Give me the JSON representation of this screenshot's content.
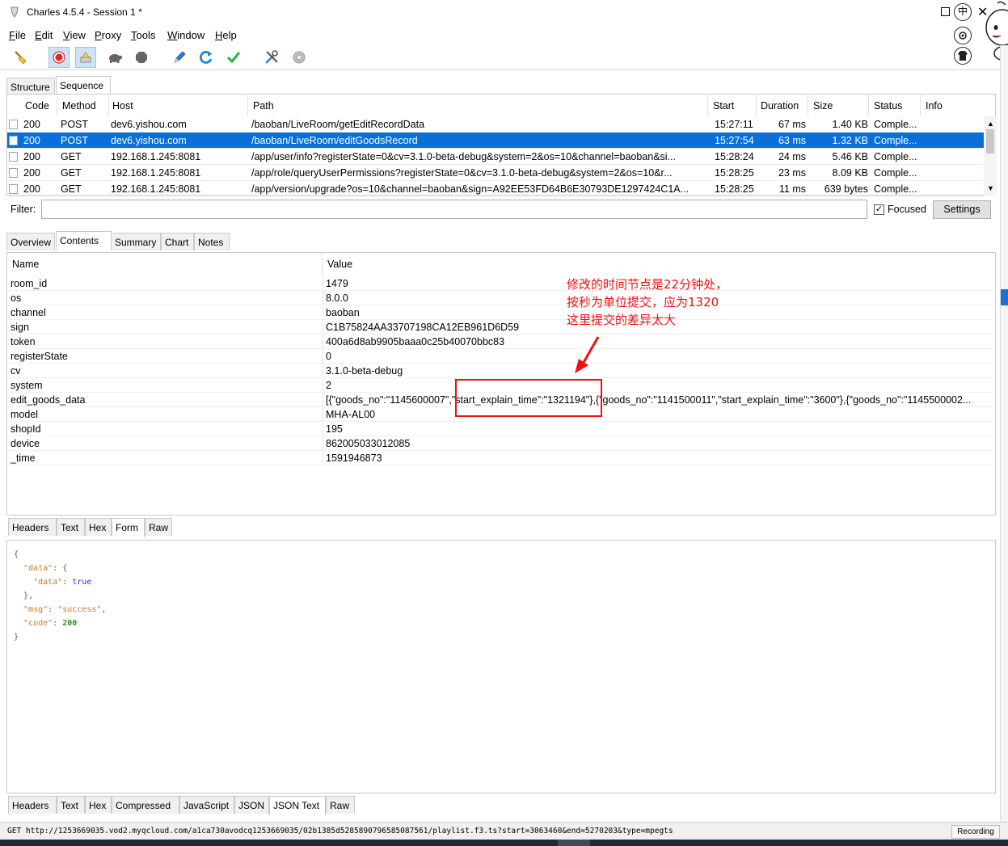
{
  "window": {
    "title": "Charles 4.5.4 - Session 1 *",
    "close_glyph": "✕",
    "ime_glyph": "中"
  },
  "menu": [
    {
      "label": "File",
      "mnemonic": "F",
      "rest": "ile"
    },
    {
      "label": "Edit",
      "mnemonic": "E",
      "rest": "dit"
    },
    {
      "label": "View",
      "mnemonic": "V",
      "rest": "iew"
    },
    {
      "label": "Proxy",
      "mnemonic": "P",
      "rest": "roxy"
    },
    {
      "label": "Tools",
      "mnemonic": "T",
      "rest": "ools"
    },
    {
      "label": "Window",
      "mnemonic": "W",
      "rest": "indow"
    },
    {
      "label": "Help",
      "mnemonic": "H",
      "rest": "elp"
    }
  ],
  "toolbar_icons": [
    "broom-icon",
    "record-icon",
    "throttle-icon",
    "turtle-icon",
    "stop-icon",
    "pen-icon",
    "refresh-icon",
    "checkmark-icon",
    "tools-icon",
    "gear-icon"
  ],
  "view_tabs": {
    "structure": "Structure",
    "sequence": "Sequence"
  },
  "columns": {
    "code": "Code",
    "method": "Method",
    "host": "Host",
    "path": "Path",
    "start": "Start",
    "duration": "Duration",
    "size": "Size",
    "status": "Status",
    "info": "Info"
  },
  "rows": [
    {
      "code": "200",
      "method": "POST",
      "host": "dev6.yishou.com",
      "path": "/baoban/LiveRoom/getEditRecordData",
      "start": "15:27:11",
      "duration": "67 ms",
      "size": "1.40 KB",
      "status": "Comple..."
    },
    {
      "code": "200",
      "method": "POST",
      "host": "dev6.yishou.com",
      "path": "/baoban/LiveRoom/editGoodsRecord",
      "start": "15:27:54",
      "duration": "63 ms",
      "size": "1.32 KB",
      "status": "Comple..."
    },
    {
      "code": "200",
      "method": "GET",
      "host": "192.168.1.245:8081",
      "path": "/app/user/info?registerState=0&cv=3.1.0-beta-debug&system=2&os=10&channel=baoban&si...",
      "start": "15:28:24",
      "duration": "24 ms",
      "size": "5.46 KB",
      "status": "Comple..."
    },
    {
      "code": "200",
      "method": "GET",
      "host": "192.168.1.245:8081",
      "path": "/app/role/queryUserPermissions?registerState=0&cv=3.1.0-beta-debug&system=2&os=10&r...",
      "start": "15:28:25",
      "duration": "23 ms",
      "size": "8.09 KB",
      "status": "Comple..."
    },
    {
      "code": "200",
      "method": "GET",
      "host": "192.168.1.245:8081",
      "path": "/app/version/upgrade?os=10&channel=baoban&sign=A92EE53FD64B6E30793DE1297424C1A...",
      "start": "15:28:25",
      "duration": "11 ms",
      "size": "639 bytes",
      "status": "Comple..."
    }
  ],
  "filter": {
    "label": "Filter:",
    "value": "",
    "focused_label": "Focused",
    "focused_checked": true,
    "settings_label": "Settings"
  },
  "detail_tabs": {
    "overview": "Overview",
    "contents": "Contents",
    "summary": "Summary",
    "chart": "Chart",
    "notes": "Notes"
  },
  "form": {
    "name_header": "Name",
    "value_header": "Value",
    "fields": [
      {
        "name": "room_id",
        "value": "1479"
      },
      {
        "name": "os",
        "value": "8.0.0"
      },
      {
        "name": "channel",
        "value": "baoban"
      },
      {
        "name": "sign",
        "value": "C1B75824AA33707198CA12EB961D6D59"
      },
      {
        "name": "token",
        "value": "400a6d8ab9905baaa0c25b40070bbc83"
      },
      {
        "name": "registerState",
        "value": "0"
      },
      {
        "name": "cv",
        "value": "3.1.0-beta-debug"
      },
      {
        "name": "system",
        "value": "2"
      },
      {
        "name": "edit_goods_data",
        "value": "[{\"goods_no\":\"1145600007\",\"start_explain_time\":\"1321194\"},{\"goods_no\":\"1141500011\",\"start_explain_time\":\"3600\"},{\"goods_no\":\"1145500002..."
      },
      {
        "name": "model",
        "value": "MHA-AL00"
      },
      {
        "name": "shopId",
        "value": "195"
      },
      {
        "name": "device",
        "value": "862005033012085"
      },
      {
        "name": "_time",
        "value": "1591946873"
      }
    ]
  },
  "annotation": {
    "lines": [
      "修改的时间节点是22分钟处，",
      "按秒为单位提交，应为1320",
      "这里提交的差异太大"
    ],
    "color": "#ee1111"
  },
  "request_tabs": {
    "headers": "Headers",
    "text": "Text",
    "hex": "Hex",
    "form": "Form",
    "raw": "Raw"
  },
  "response": {
    "l1": "{",
    "k_data": "\"data\"",
    "colon_brace": ": {",
    "k_inner": "\"data\"",
    "colon": ": ",
    "v_true": "true",
    "close_brace": "},",
    "k_msg": "\"msg\"",
    "v_msg": "\"success\"",
    "comma": ",",
    "k_code": "\"code\"",
    "v_code": "200",
    "l_end": "}"
  },
  "response_tabs": {
    "headers": "Headers",
    "text": "Text",
    "hex": "Hex",
    "compressed": "Compressed",
    "javascript": "JavaScript",
    "json": "JSON",
    "json_text": "JSON Text",
    "raw": "Raw"
  },
  "statusbar": {
    "url": "GET http://1253669035.vod2.myqcloud.com/a1ca730avodcq1253669035/02b1385d5285890796585087561/playlist.f3.ts?start=3063460&end=5270203&type=mpegts",
    "recording": "Recording"
  },
  "colors": {
    "selection": "#0a6fd9",
    "accent_red": "#ee1111"
  }
}
